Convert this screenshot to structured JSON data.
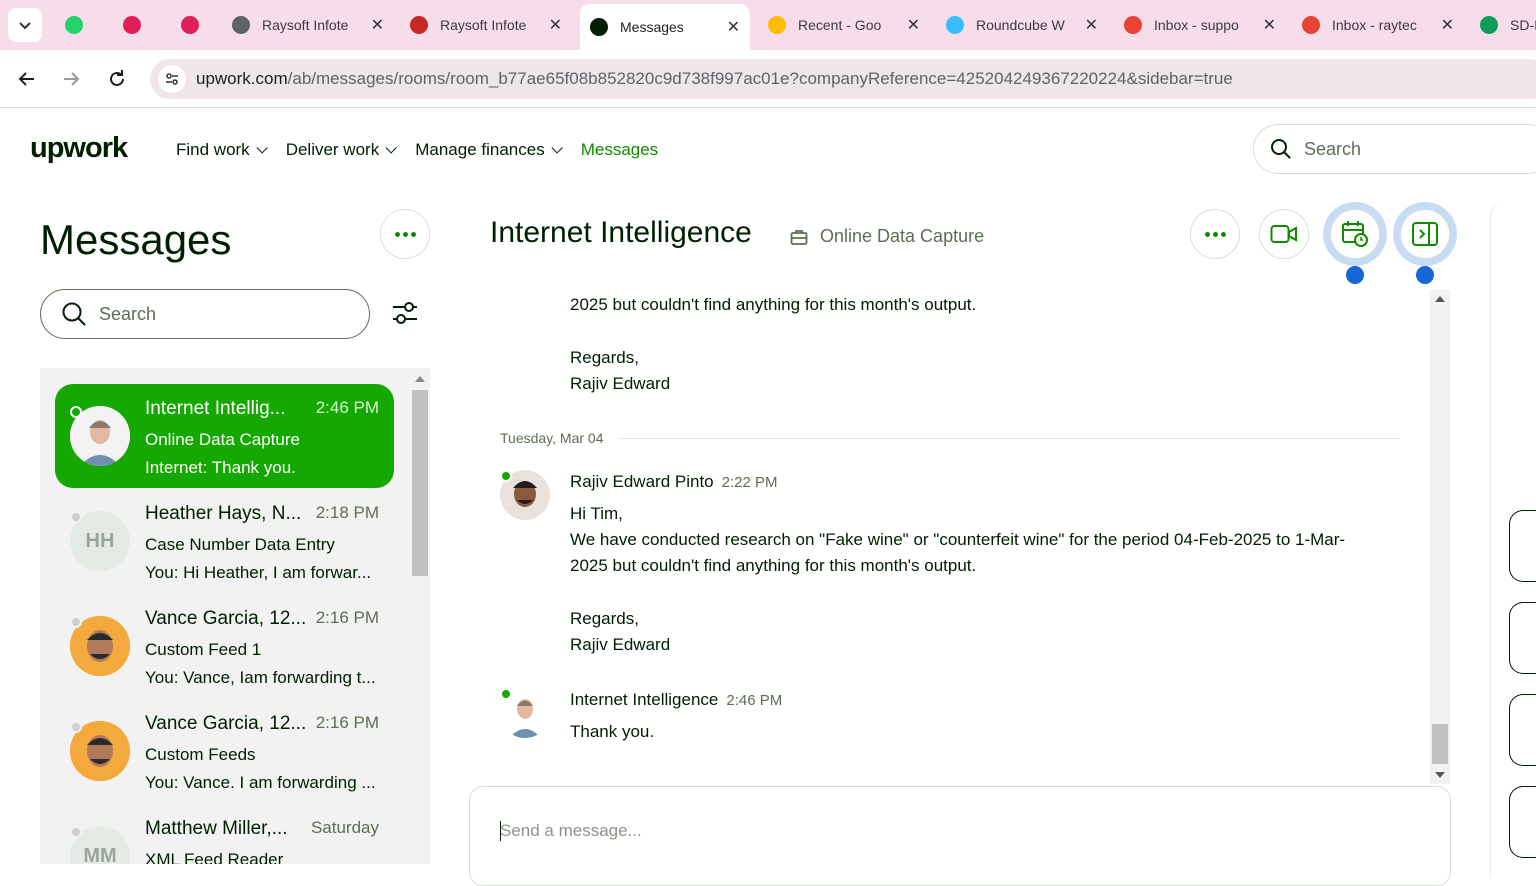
{
  "browser": {
    "tabs": [
      {
        "title": "",
        "icon": "whatsapp-icon",
        "color": "#25d366"
      },
      {
        "title": "",
        "icon": "slack-icon",
        "color": "#e01e5a"
      },
      {
        "title": "",
        "icon": "slack-icon",
        "color": "#e01e5a"
      },
      {
        "title": "Raysoft Infote",
        "icon": "globe-icon",
        "color": "#5f6368"
      },
      {
        "title": "Raysoft Infote",
        "icon": "graduation-cap-icon",
        "color": "#c62828"
      },
      {
        "title": "Messages",
        "icon": "upwork-icon",
        "color": "#001e00"
      },
      {
        "title": "Recent - Goo",
        "icon": "google-drive-icon",
        "color": "#fbbc04"
      },
      {
        "title": "Roundcube W",
        "icon": "roundcube-icon",
        "color": "#37beff"
      },
      {
        "title": "Inbox - suppo",
        "icon": "gmail-icon",
        "color": "#ea4335"
      },
      {
        "title": "Inbox - raytec",
        "icon": "gmail-icon",
        "color": "#ea4335"
      },
      {
        "title": "SD-I",
        "icon": "google-sheets-icon",
        "color": "#0f9d58"
      }
    ],
    "url_host": "upwork.com",
    "url_path": "/ab/messages/rooms/room_b77ae65f08b852820c9d738f997ac01e?companyReference=425204249367220224&sidebar=true"
  },
  "header": {
    "logo": "upwork",
    "nav": [
      {
        "label": "Find work",
        "dropdown": true
      },
      {
        "label": "Deliver work",
        "dropdown": true
      },
      {
        "label": "Manage finances",
        "dropdown": true
      },
      {
        "label": "Messages",
        "dropdown": false
      }
    ],
    "search_placeholder": "Search"
  },
  "sidebar": {
    "title": "Messages",
    "search_placeholder": "Search",
    "conversations": [
      {
        "name": "Internet Intellig...",
        "time": "2:46 PM",
        "subject": "Online Data Capture",
        "last": "Internet: Thank you.",
        "active": true,
        "avatar": "photo"
      },
      {
        "name": "Heather Hays, N...",
        "time": "2:18 PM",
        "subject": "Case Number Data Entry",
        "last": "You: Hi Heather, I am forwar...",
        "active": false,
        "initials": "HH"
      },
      {
        "name": "Vance Garcia, 12...",
        "time": "2:16 PM",
        "subject": "Custom Feed 1",
        "last": "You: Vance, Iam forwarding t...",
        "active": false,
        "avatar": "photo"
      },
      {
        "name": "Vance Garcia, 12...",
        "time": "2:16 PM",
        "subject": "Custom Feeds",
        "last": "You: Vance. I am forwarding ...",
        "active": false,
        "avatar": "photo"
      },
      {
        "name": "Matthew Miller,...",
        "time": "Saturday",
        "subject": "XML Feed Reader",
        "last": "",
        "active": false,
        "initials": "MM"
      }
    ]
  },
  "chat": {
    "title": "Internet Intelligence",
    "contract": "Online Data Capture",
    "prev_tail": "2025 but couldn't find anything for this month's output.",
    "prev_regards": "Regards,",
    "prev_sign": "Rajiv Edward",
    "date_separator": "Tuesday, Mar 04",
    "messages": [
      {
        "sender": "Rajiv Edward Pinto",
        "time": "2:22 PM",
        "lines": [
          "Hi Tim,",
          "We have conducted research on \"Fake wine\" or \"counterfeit wine\" for the period 04-Feb-2025 to 1-Mar-",
          "2025 but couldn't find anything for this month's output.",
          "",
          "Regards,",
          "Rajiv Edward"
        ]
      },
      {
        "sender": "Internet Intelligence",
        "time": "2:46 PM",
        "lines": [
          "Thank you."
        ]
      }
    ],
    "composer_placeholder": "Send a message..."
  },
  "colors": {
    "brand": "#14a800",
    "accent_blue": "#1766d6"
  }
}
